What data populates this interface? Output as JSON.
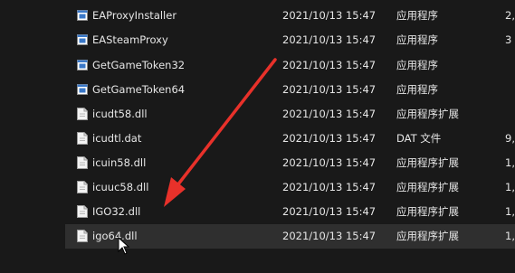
{
  "files": [
    {
      "name": "EAProxyInstaller",
      "date": "2021/10/13 15:47",
      "type": "应用程序",
      "size": "2,0",
      "icon": "app-icon"
    },
    {
      "name": "EASteamProxy",
      "date": "2021/10/13 15:47",
      "type": "应用程序",
      "size": "3",
      "icon": "app-icon"
    },
    {
      "name": "GetGameToken32",
      "date": "2021/10/13 15:47",
      "type": "应用程序",
      "size": "",
      "icon": "app-icon"
    },
    {
      "name": "GetGameToken64",
      "date": "2021/10/13 15:47",
      "type": "应用程序",
      "size": "",
      "icon": "app-icon"
    },
    {
      "name": "icudt58.dll",
      "date": "2021/10/13 15:47",
      "type": "应用程序扩展",
      "size": "",
      "icon": "file-icon"
    },
    {
      "name": "icudtl.dat",
      "date": "2021/10/13 15:47",
      "type": "DAT 文件",
      "size": "9,8",
      "icon": "file-icon"
    },
    {
      "name": "icuin58.dll",
      "date": "2021/10/13 15:47",
      "type": "应用程序扩展",
      "size": "1,7",
      "icon": "file-icon"
    },
    {
      "name": "icuuc58.dll",
      "date": "2021/10/13 15:47",
      "type": "应用程序扩展",
      "size": "1,2",
      "icon": "file-icon"
    },
    {
      "name": "IGO32.dll",
      "date": "2021/10/13 15:47",
      "type": "应用程序扩展",
      "size": "1,",
      "icon": "file-icon"
    },
    {
      "name": "igo64.dll",
      "date": "2021/10/13 15:47",
      "type": "应用程序扩展",
      "size": "1,5",
      "icon": "file-icon"
    }
  ],
  "colors": {
    "background": "#191919",
    "selected_row": "#2f2f2f",
    "arrow": "#e8312a",
    "app_icon": "#3a78c8"
  }
}
